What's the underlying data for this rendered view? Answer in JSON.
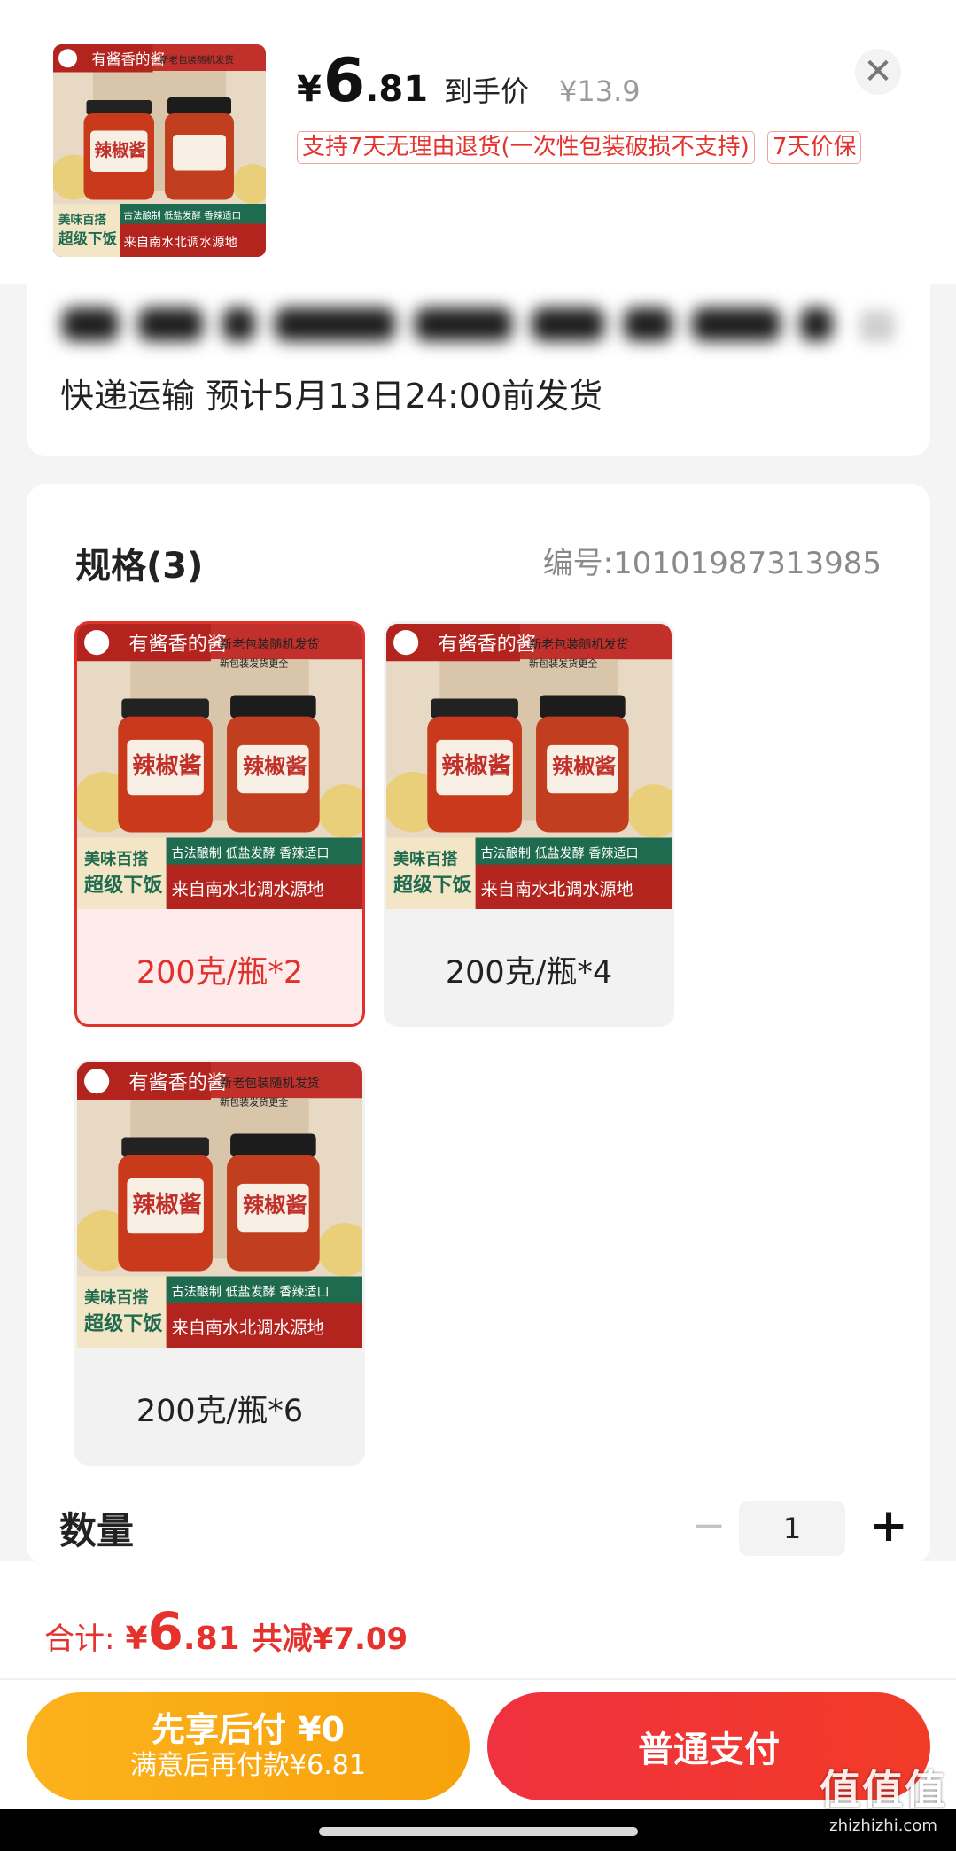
{
  "header": {
    "price_currency": "¥",
    "price_int": "6",
    "price_dec": ".81",
    "price_note": "到手价",
    "original_price": "¥13.9",
    "tags": [
      "支持7天无理由退货(一次性包装破损不支持)",
      "7天价保"
    ],
    "close_icon": "✕"
  },
  "product_image": {
    "brand": "有酱香的酱",
    "promo": "新老包装随机发货",
    "subpromo": "新包装发货更全",
    "jar_label": "辣椒酱",
    "jar_sub": "有酱香的酱",
    "slogan1": "美味百搭",
    "slogan2": "超级下饭",
    "feature": "古法酿制 低盐发酵 香辣适口",
    "origin": "来自南水北调水源地"
  },
  "shipping": {
    "text": "快递运输 预计5月13日24:00前发货"
  },
  "spec": {
    "title": "规格(3)",
    "code": "编号:10101987313985",
    "options": [
      {
        "label": "200克/瓶*2",
        "selected": true
      },
      {
        "label": "200克/瓶*4",
        "selected": false
      },
      {
        "label": "200克/瓶*6",
        "selected": false
      }
    ]
  },
  "quantity": {
    "label": "数量",
    "value": "1",
    "minus": "−",
    "plus": "+"
  },
  "total": {
    "label": "合计:",
    "currency": "¥",
    "amount_int": "6",
    "amount_dec": ".81",
    "saved": "共减¥7.09"
  },
  "buttons": {
    "bnpl_line1": "先享后付 ¥0",
    "bnpl_line2": "满意后再付款¥6.81",
    "pay": "普通支付"
  },
  "watermark": {
    "main": "值值值",
    "url": "zhizhizhi.com"
  },
  "colors": {
    "accent": "#e5322d",
    "bnpl": "#fcb21d",
    "pay": "#f0313f"
  }
}
